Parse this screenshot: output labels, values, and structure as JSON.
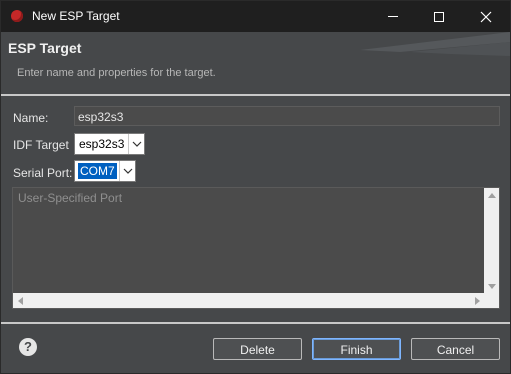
{
  "window": {
    "title": "New ESP Target"
  },
  "header": {
    "title": "ESP Target",
    "description": "Enter name and properties for the target."
  },
  "form": {
    "name_label": "Name:",
    "name_value": "esp32s3",
    "idf_target_label": "IDF Target",
    "idf_target_value": "esp32s3",
    "serial_port_label": "Serial Port:",
    "serial_port_value": "COM7",
    "custom_port_placeholder": "User-Specified Port"
  },
  "footer": {
    "help_glyph": "?",
    "delete_label": "Delete",
    "finish_label": "Finish",
    "cancel_label": "Cancel"
  },
  "colors": {
    "background": "#46484a",
    "titlebar": "#1f1f1f",
    "selection": "#0060c0"
  }
}
